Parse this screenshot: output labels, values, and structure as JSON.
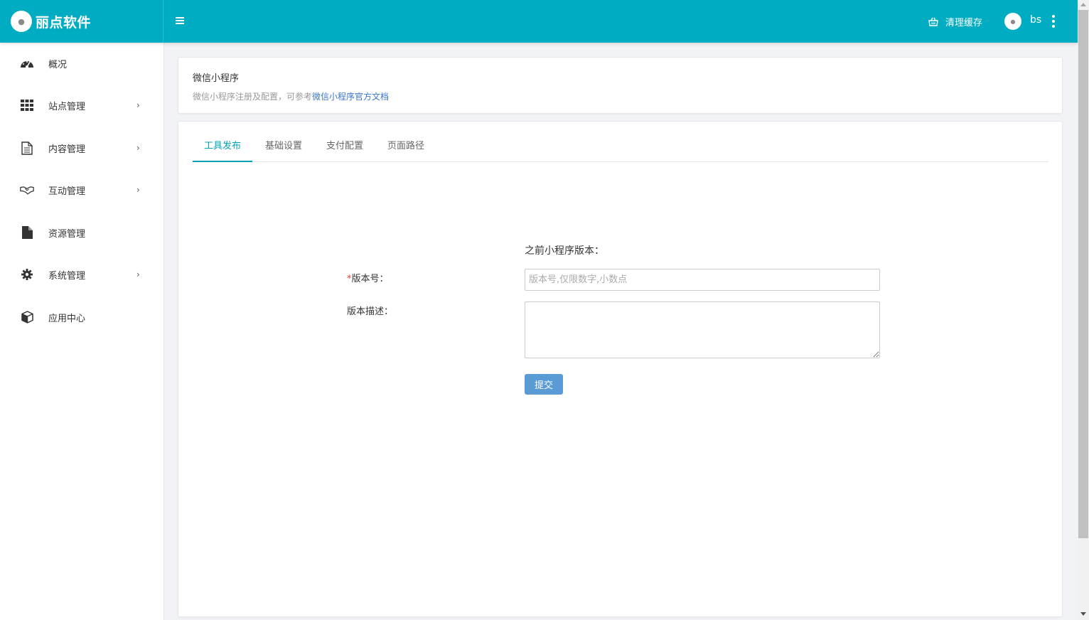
{
  "header": {
    "logo_text": "丽点软件",
    "menu_icon": "hamburger-icon",
    "clear_cache_label": "清理缓存",
    "clear_cache_icon": "basket-icon",
    "username": "bs",
    "more_icon": "more-vertical-icon"
  },
  "sidebar": {
    "items": [
      {
        "label": "概况",
        "icon": "dashboard-icon",
        "has_submenu": false
      },
      {
        "label": "站点管理",
        "icon": "grid-icon",
        "has_submenu": true
      },
      {
        "label": "内容管理",
        "icon": "document-icon",
        "has_submenu": true
      },
      {
        "label": "互动管理",
        "icon": "handshake-icon",
        "has_submenu": true
      },
      {
        "label": "资源管理",
        "icon": "file-icon",
        "has_submenu": false
      },
      {
        "label": "系统管理",
        "icon": "gear-icon",
        "has_submenu": true
      },
      {
        "label": "应用中心",
        "icon": "cube-icon",
        "has_submenu": false
      }
    ],
    "chevron": "›"
  },
  "intro": {
    "title": "微信小程序",
    "description": "微信小程序注册及配置，可参考",
    "link_text": "微信小程序官方文档"
  },
  "tabs": [
    {
      "label": "工具发布",
      "active": true
    },
    {
      "label": "基础设置",
      "active": false
    },
    {
      "label": "支付配置",
      "active": false
    },
    {
      "label": "页面路径",
      "active": false
    }
  ],
  "form": {
    "previous_version_label": "之前小程序版本：",
    "version_required_mark": "*",
    "version_label": "版本号：",
    "version_value": "",
    "version_placeholder": "版本号,仅限数字,小数点",
    "description_label": "版本描述：",
    "description_value": "",
    "submit_label": "提交"
  },
  "colors": {
    "header_bg": "#00acc1",
    "tab_active": "#00a2b5",
    "link": "#3b77c9",
    "submit_bg": "#5b9bd5",
    "required": "#e53935"
  }
}
